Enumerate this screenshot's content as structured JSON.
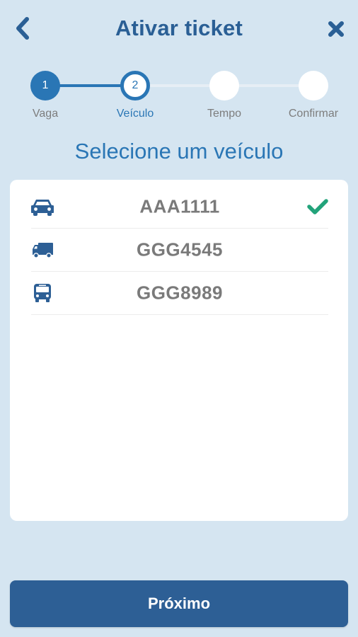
{
  "header": {
    "title": "Ativar ticket",
    "back_icon": "chevron-left-icon",
    "close_icon": "close-icon"
  },
  "stepper": {
    "steps": [
      {
        "number": "1",
        "label": "Vaga",
        "state": "done"
      },
      {
        "number": "2",
        "label": "Veículo",
        "state": "current"
      },
      {
        "number": "",
        "label": "Tempo",
        "state": "pending"
      },
      {
        "number": "",
        "label": "Confirmar",
        "state": "pending"
      }
    ]
  },
  "subtitle": "Selecione um veículo",
  "vehicles": [
    {
      "plate": "AAA1111",
      "icon": "car-icon",
      "selected": true
    },
    {
      "plate": "GGG4545",
      "icon": "truck-icon",
      "selected": false
    },
    {
      "plate": "GGG8989",
      "icon": "bus-icon",
      "selected": false
    }
  ],
  "actions": {
    "next_label": "Próximo"
  },
  "colors": {
    "background": "#d5e5f1",
    "primary": "#2a76b5",
    "title": "#2a5f95",
    "button": "#2d5f95",
    "check": "#22a37a"
  }
}
